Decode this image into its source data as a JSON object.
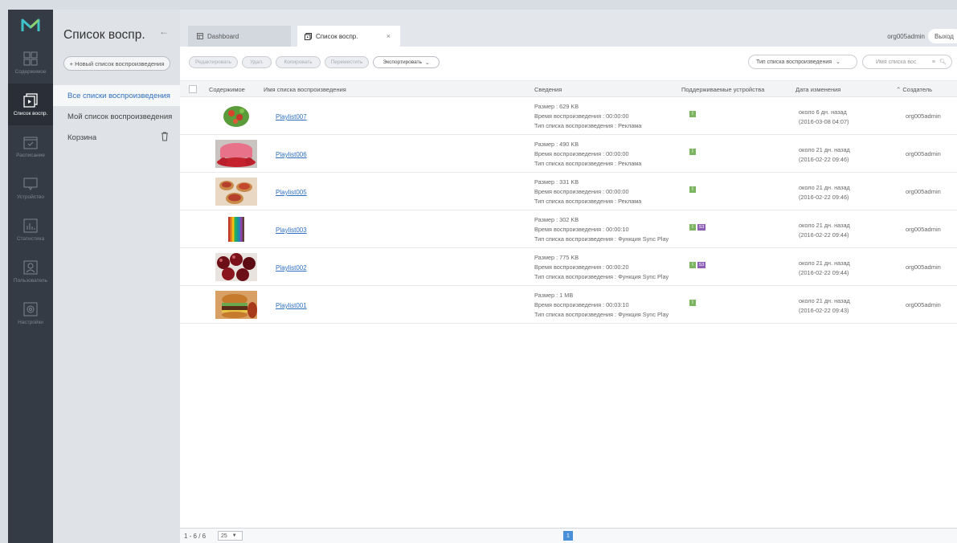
{
  "rail": {
    "items": [
      {
        "label": "Содержимое",
        "icon": "content-grid-icon"
      },
      {
        "label": "Список воспр.",
        "icon": "playlist-icon"
      },
      {
        "label": "Расписание",
        "icon": "calendar-icon"
      },
      {
        "label": "Устройство",
        "icon": "monitor-icon"
      },
      {
        "label": "Статистика",
        "icon": "statistics-icon"
      },
      {
        "label": "Пользователь",
        "icon": "user-icon"
      },
      {
        "label": "Настройки",
        "icon": "gear-icon"
      }
    ],
    "active": 1
  },
  "sidebar": {
    "title": "Список воспр.",
    "new_button": "+ Новый список воспроизведения",
    "items": [
      {
        "label": "Все списки воспроизведения"
      },
      {
        "label": "Мой список воспроизведения"
      },
      {
        "label": "Корзина"
      }
    ]
  },
  "tabs": [
    {
      "label": "Dashboard"
    },
    {
      "label": "Список воспр.",
      "close": "×"
    }
  ],
  "header": {
    "user": "org005admin",
    "logout": "Выход"
  },
  "toolbar": {
    "edit": "Редактировать",
    "delete": "Удал.",
    "copy": "Копировать",
    "move": "Переместить",
    "export": "Экспортировать",
    "type_filter": "Тип списка воспроизведения",
    "search_placeholder": "Имя списка вос"
  },
  "table": {
    "headers": {
      "content": "Содержимое",
      "name": "Имя списка воспроизведения",
      "info": "Сведения",
      "devices": "Поддерживаемые устройства",
      "date": "Дата изменения",
      "creator": "Создатель"
    },
    "rows": [
      {
        "name": "Playlist007",
        "size": "Размер : 629 KB",
        "duration": "Время воспроизведения : 00:00:00",
        "type": "Тип списка воспроизведения : Реклама",
        "badges": [
          "I"
        ],
        "date_rel": "около 6 дн. назад",
        "date_abs": "(2016-03-08 04:07)",
        "creator": "org005admin",
        "thumb": "salad-thumb"
      },
      {
        "name": "Playlist006",
        "size": "Размер : 490 KB",
        "duration": "Время воспроизведения : 00:00:00",
        "type": "Тип списка воспроизведения : Реклама",
        "badges": [
          "I"
        ],
        "date_rel": "около 21 дн. назад",
        "date_abs": "(2016-02-22 09:46)",
        "creator": "org005admin",
        "thumb": "cake-thumb"
      },
      {
        "name": "Playlist005",
        "size": "Размер : 331 KB",
        "duration": "Время воспроизведения : 00:00:00",
        "type": "Тип списка воспроизведения : Реклама",
        "badges": [
          "I"
        ],
        "date_rel": "около 21 дн. назад",
        "date_abs": "(2016-02-22 09:46)",
        "creator": "org005admin",
        "thumb": "tarts-thumb"
      },
      {
        "name": "Playlist003",
        "size": "Размер : 302 KB",
        "duration": "Время воспроизведения : 00:00:10",
        "type": "Тип списка воспроизведения : Функция Sync Play",
        "badges": [
          "I",
          "S3"
        ],
        "date_rel": "около 21 дн. назад",
        "date_abs": "(2016-02-22 09:44)",
        "creator": "org005admin",
        "thumb": "pencils-thumb"
      },
      {
        "name": "Playlist002",
        "size": "Размер : 775 KB",
        "duration": "Время воспроизведения : 00:00:20",
        "type": "Тип списка воспроизведения : Функция Sync Play",
        "badges": [
          "I",
          "S3"
        ],
        "date_rel": "около 21 дн. назад",
        "date_abs": "(2016-02-22 09:44)",
        "creator": "org005admin",
        "thumb": "cherries-thumb"
      },
      {
        "name": "Playlist001",
        "size": "Размер : 1 MB",
        "duration": "Время воспроизведения : 00:03:10",
        "type": "Тип списка воспроизведения : Функция Sync Play",
        "badges": [
          "I"
        ],
        "date_rel": "около 21 дн. назад",
        "date_abs": "(2016-02-22 09:43)",
        "creator": "org005admin",
        "thumb": "burger-thumb"
      }
    ]
  },
  "pagination": {
    "info": "1 - 6 / 6",
    "page_size": "25",
    "current": "1"
  },
  "colors": {
    "rail": "#353b44",
    "accent": "#2f6fbf",
    "badge_i": "#7cb55f",
    "badge_s": "#8e5fb5"
  }
}
